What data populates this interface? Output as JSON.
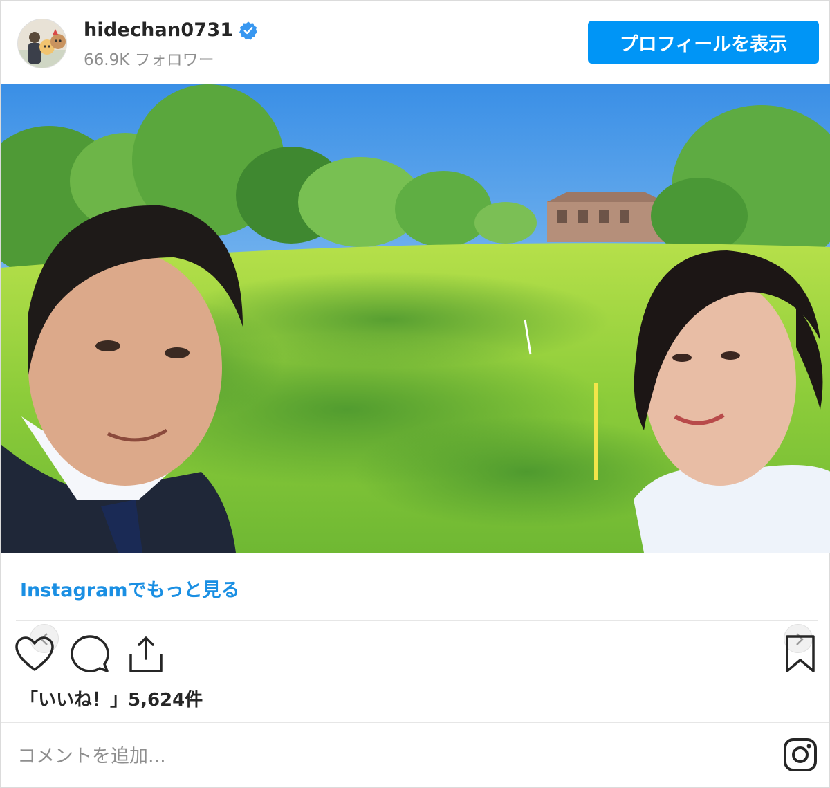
{
  "header": {
    "username": "hidechan0731",
    "verified": true,
    "followers": "66.9K フォロワー",
    "profile_button": "プロフィールを表示",
    "avatar_icon": "profile-avatar"
  },
  "colors": {
    "accent_button": "#0095f6",
    "link": "#1a8fe3",
    "verified_badge": "#3897f0"
  },
  "post": {
    "more_link": "Instagramでもっと見る",
    "likes_text": "「いいね！」5,624件",
    "icons": [
      "heart-icon",
      "comment-icon",
      "share-icon",
      "bookmark-icon",
      "instagram-icon"
    ]
  },
  "comment": {
    "placeholder": "コメントを追加..."
  }
}
